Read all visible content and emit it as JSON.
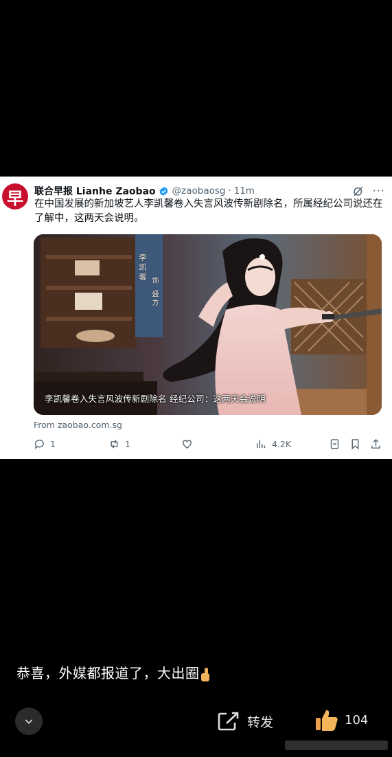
{
  "tweet": {
    "avatar_glyph": "早",
    "display_name": "联合早报 Lianhe Zaobao",
    "handle": "@zaobaosg",
    "time": "11m",
    "text": "在中国发展的新加坡艺人李凯馨卷入失言风波传新剧除名，所属经纪公司说还在了解中，这两天会说明。",
    "media_caption": "李凯馨卷入失言风波传新剧除名 经纪公司：这两天会说明",
    "media_vertical_name": "李凯馨",
    "media_vertical_role": "饰 盛方",
    "source": "From zaobao.com.sg",
    "replies": "1",
    "reposts": "1",
    "views": "4.2K",
    "colors": {
      "avatar": "#c8102e",
      "verified": "#1d9bf0",
      "text": "#0f1419",
      "muted": "#536471"
    }
  },
  "post": {
    "comment": "恭喜，外媒都报道了，大出圈",
    "repost_label": "转发",
    "like_count": "104",
    "icons": [
      "chevron-down-icon",
      "share-icon",
      "thumbs-up-icon"
    ]
  }
}
